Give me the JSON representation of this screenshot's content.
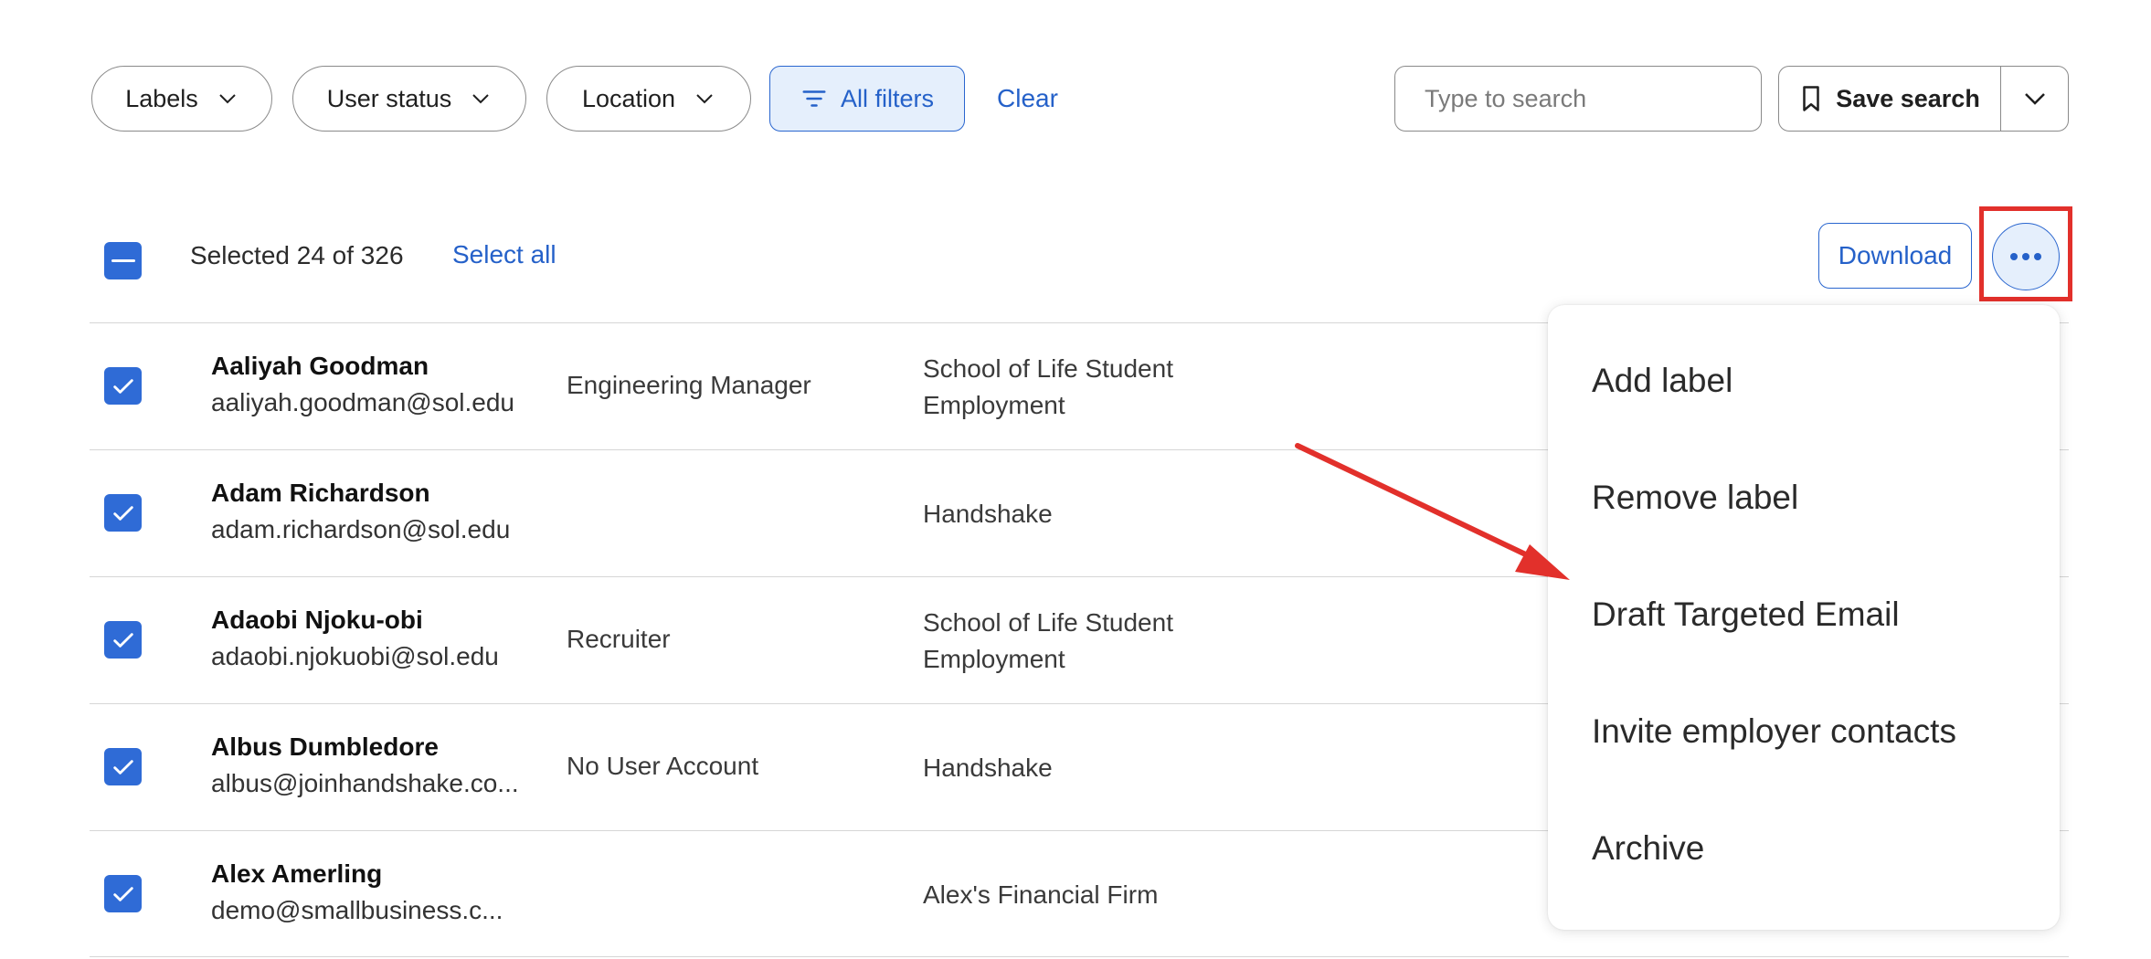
{
  "filters": {
    "labels": "Labels",
    "user_status": "User status",
    "location": "Location",
    "all_filters": "All filters",
    "clear": "Clear"
  },
  "search": {
    "placeholder": "Type to search"
  },
  "save_search": {
    "label": "Save search"
  },
  "selection": {
    "selected_text": "Selected 24 of 326",
    "select_all": "Select all",
    "download": "Download"
  },
  "rows": [
    {
      "name": "Aaliyah Goodman",
      "email": "aaliyah.goodman@sol.edu",
      "role": "Engineering Manager",
      "org_line1": "School of Life Student",
      "org_line2": "Employment",
      "checked": true
    },
    {
      "name": "Adam Richardson",
      "email": "adam.richardson@sol.edu",
      "role": "",
      "org_line1": "Handshake",
      "org_line2": "",
      "checked": true
    },
    {
      "name": "Adaobi Njoku-obi",
      "email": "adaobi.njokuobi@sol.edu",
      "role": "Recruiter",
      "org_line1": "School of Life Student",
      "org_line2": "Employment",
      "checked": true
    },
    {
      "name": "Albus Dumbledore",
      "email": "albus@joinhandshake.co...",
      "role": "No User Account",
      "org_line1": "Handshake",
      "org_line2": "",
      "checked": true
    },
    {
      "name": "Alex Amerling",
      "email": "demo@smallbusiness.c...",
      "role": "",
      "org_line1": "Alex's Financial Firm",
      "org_line2": "",
      "checked": true
    }
  ],
  "menu": {
    "items": [
      "Add label",
      "Remove label",
      "Draft Targeted Email",
      "Invite employer contacts",
      "Archive"
    ]
  },
  "colors": {
    "accent": "#2561c9",
    "checkbox": "#2f6bd6",
    "annotation": "#e2302b"
  }
}
